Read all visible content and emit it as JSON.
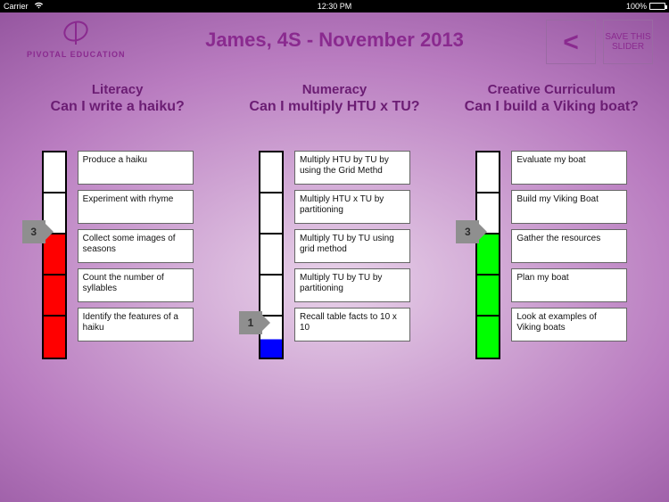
{
  "statusbar": {
    "carrier": "Carrier",
    "wifi_icon": "wifi-icon",
    "time": "12:30 PM",
    "battery_pct": "100%"
  },
  "header": {
    "brand": "PIVOTAL EDUCATION",
    "title": "James, 4S - November 2013",
    "back_label": "<",
    "save_label": "SAVE THIS SLIDER"
  },
  "columns": [
    {
      "subject": "Literacy",
      "question": "Can I write a haiku?",
      "slider_value": "3",
      "segments": [
        "white",
        "white",
        "red",
        "red",
        "red"
      ],
      "steps": [
        "Produce a haiku",
        "Experiment with rhyme",
        "Collect some images of seasons",
        "Count the number of syllables",
        "Identify the features of a haiku"
      ]
    },
    {
      "subject": "Numeracy",
      "question": "Can I multiply HTU x TU?",
      "slider_value": "1",
      "segments": [
        "white",
        "white",
        "white",
        "white",
        "blue"
      ],
      "steps": [
        "Multiply HTU by TU by using the Grid Methd",
        "Multiply HTU x TU by partitioning",
        "Multiply TU by TU using grid method",
        "Multiply TU by TU by partitioning",
        "Recall table facts to 10 x 10"
      ]
    },
    {
      "subject": "Creative Curriculum",
      "question": "Can I build a Viking boat?",
      "slider_value": "3",
      "segments": [
        "white",
        "white",
        "green",
        "green",
        "green"
      ],
      "steps": [
        "Evaluate my boat",
        "Build my Viking Boat",
        "Gather the resources",
        "Plan my boat",
        "Look at examples of Viking boats"
      ]
    }
  ]
}
